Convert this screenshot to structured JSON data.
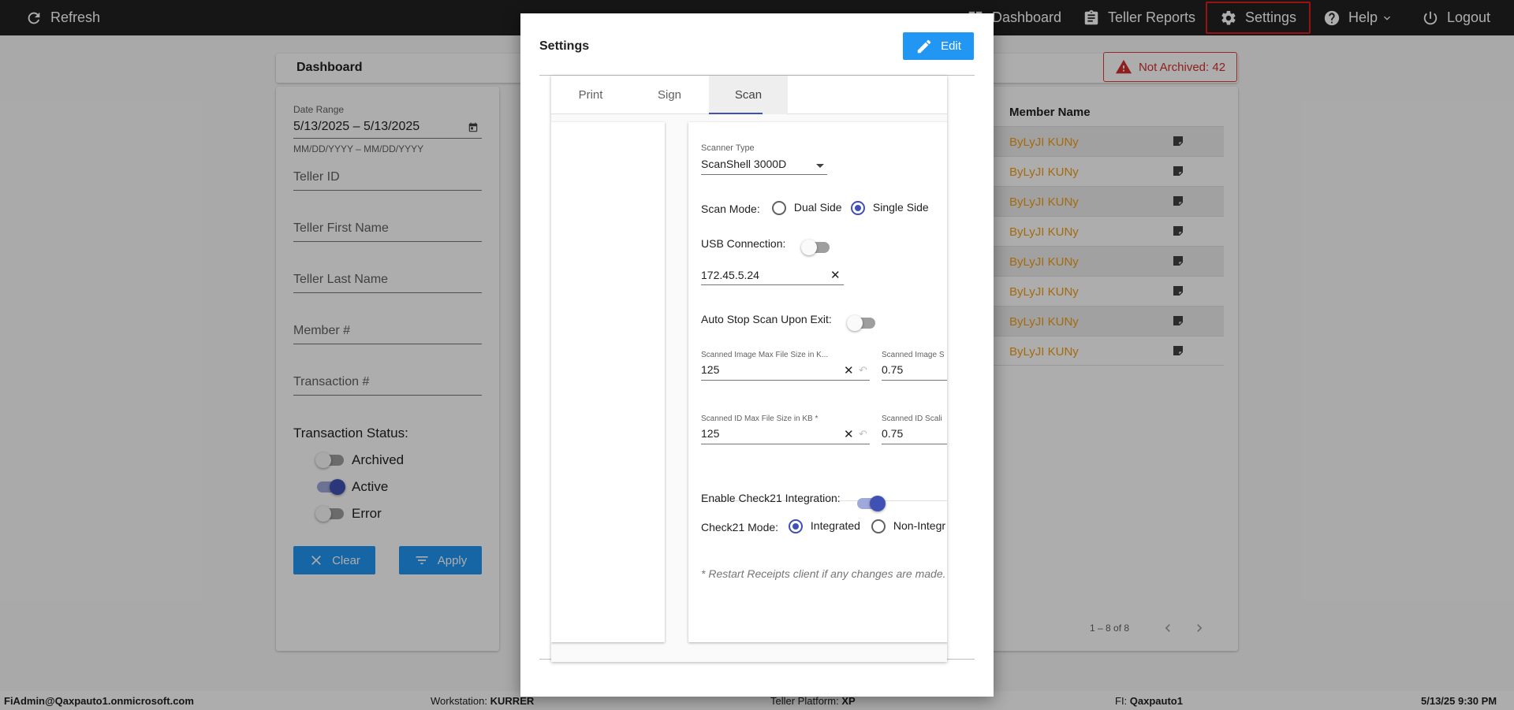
{
  "nav": {
    "refresh_label": "Refresh",
    "dashboard_label": "Dashboard",
    "teller_reports_label": "Teller Reports",
    "settings_label": "Settings",
    "help_label": "Help",
    "logout_label": "Logout"
  },
  "dashboard": {
    "title": "Dashboard",
    "badge_label": "Not Archived: 42"
  },
  "filters": {
    "date_range_label": "Date Range",
    "date_range_value": "5/13/2025 – 5/13/2025",
    "date_range_hint": "MM/DD/YYYY – MM/DD/YYYY",
    "teller_id_label": "Teller ID",
    "teller_first_label": "Teller First Name",
    "teller_last_label": "Teller Last Name",
    "member_label": "Member #",
    "transaction_label": "Transaction #",
    "status_title": "Transaction Status:",
    "statuses": [
      {
        "label": "Archived",
        "on": false
      },
      {
        "label": "Active",
        "on": true
      },
      {
        "label": "Error",
        "on": false
      }
    ],
    "clear_label": "Clear",
    "apply_label": "Apply"
  },
  "results": {
    "column_header": "Member Name",
    "rows": [
      "ByLyJI KUNy",
      "ByLyJI KUNy",
      "ByLyJI KUNy",
      "ByLyJI KUNy",
      "ByLyJI KUNy",
      "ByLyJI KUNy",
      "ByLyJI KUNy",
      "ByLyJI KUNy"
    ],
    "pager_text": "1 – 8 of 8"
  },
  "footer": {
    "user": "FiAdmin@Qaxpauto1.onmicrosoft.com",
    "workstation_label": "Workstation:",
    "workstation_value": "KURRER",
    "platform_label": "Teller Platform:",
    "platform_value": "XP",
    "fi_label": "FI:",
    "fi_value": "Qaxpauto1",
    "datetime": "5/13/25 9:30 PM"
  },
  "dialog": {
    "title": "Settings",
    "edit_label": "Edit",
    "tabs": [
      {
        "label": "Print",
        "active": false
      },
      {
        "label": "Sign",
        "active": false
      },
      {
        "label": "Scan",
        "active": true
      }
    ],
    "scan": {
      "scanner_type_label": "Scanner Type",
      "scanner_type_value": "ScanShell 3000D",
      "scan_mode_label": "Scan Mode:",
      "scan_mode_options": [
        {
          "label": "Dual Side",
          "selected": false
        },
        {
          "label": "Single Side",
          "selected": true
        }
      ],
      "usb_label": "USB Connection:",
      "usb_on": false,
      "ip_value": "172.45.5.24",
      "auto_stop_label": "Auto Stop Scan Upon Exit:",
      "auto_stop_on": false,
      "img_max_label": "Scanned Image Max File Size in K...",
      "img_max_value": "125",
      "img_scale_label": "Scanned Image S",
      "img_scale_value": "0.75",
      "id_max_label": "Scanned ID Max File Size in KB *",
      "id_max_value": "125",
      "id_scale_label": "Scanned ID Scali",
      "id_scale_value": "0.75",
      "check21_label": "Enable Check21 Integration:",
      "check21_on": true,
      "check21_mode_label": "Check21 Mode:",
      "check21_mode_options": [
        {
          "label": "Integrated",
          "selected": true
        },
        {
          "label": "Non-Integr",
          "selected": false
        }
      ],
      "restart_note": "* Restart Receipts client if any changes are made."
    }
  }
}
